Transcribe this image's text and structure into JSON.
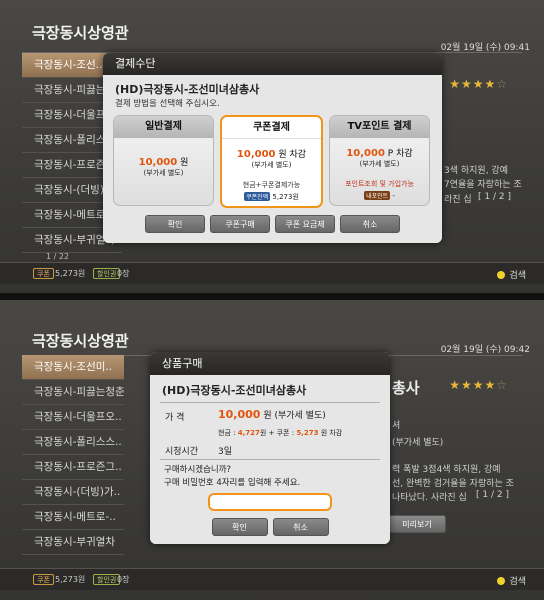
{
  "screen1": {
    "category_title": "극장동시상영관",
    "clock": "02월 19일 (수) 09:41",
    "menu": [
      "극장동시-조선..",
      "극장동시-피끓는",
      "극장동시-더울프",
      "극장동시-폴리스",
      "극장동시-프로즌",
      "극장동시-(더빙)",
      "극장동시-메트로",
      "극장동시-부귀열차"
    ],
    "page_indicator": "1 / 22",
    "bottom": {
      "coupon_label": "쿠폰",
      "coupon_value": "5,273원",
      "discount_label": "할인권",
      "discount_value": "0장",
      "search_label": "검색"
    },
    "desc_line1": "3색 하지원, 강예",
    "desc_line2": "7연율을 자랑하는 조",
    "desc_line3": "라진 십",
    "desc_page": "[ 1 / 2 ]",
    "stars": "★★★★",
    "star_empty": "☆",
    "dialog": {
      "header": "결제수단",
      "product_title": "(HD)극장동시-조선미녀삼총사",
      "subtitle": "결제 방법을 선택해 주십시오.",
      "cards": [
        {
          "title": "일반결제",
          "price": "10,000",
          "unit": " 원",
          "vat": "(부가세 별도)",
          "note": "",
          "row_tag": "",
          "row_text": ""
        },
        {
          "title": "쿠폰결제",
          "price": "10,000",
          "unit": " 원 차감",
          "vat": "(부가세 별도)",
          "note": "현금+쿠폰결제가능",
          "row_tag": "쿠폰잔액",
          "row_text": "5,273원"
        },
        {
          "title": "TV포인트 결제",
          "price": "10,000",
          "unit": " P 차감",
          "vat": "(부가세 별도)",
          "note": "포인트조회 및 가입가능",
          "row_tag": "내포인트",
          "row_text": "-"
        }
      ],
      "buttons": [
        "확인",
        "쿠폰구매",
        "쿠폰 요금제",
        "취소"
      ]
    }
  },
  "screen2": {
    "category_title": "극장동시상영관",
    "clock": "02월 19일 (수) 09:42",
    "menu": [
      "극장동시-조선미..",
      "극장동시-피끓는청춘",
      "극장동시-더울프오..",
      "극장동시-폴리스스..",
      "극장동시-프로즌그..",
      "극장동시-(더빙)가..",
      "극장동시-메트로-..",
      "극장동시-부귀열차"
    ],
    "bg_title": "총사",
    "stars": "★★★★",
    "star_empty": "☆",
    "desc_line0": "셔",
    "desc_vat": "(부가세 별도)",
    "desc_line1": "력 폭발 3점4색 하지원, 강예",
    "desc_line2": "선, 완벽한 검거율을 자랑하는 조",
    "desc_line3": "나타났다. 사라진 십",
    "desc_page": "[ 1 / 2 ]",
    "preview_label": "미리보기",
    "bottom": {
      "coupon_label": "쿠폰",
      "coupon_value": "5,273원",
      "discount_label": "할인권",
      "discount_value": "0장",
      "search_label": "검색"
    },
    "dialog": {
      "header": "상품구매",
      "product_title": "(HD)극장동시-조선미녀삼총사",
      "price_label": "가     격",
      "price": "10,000",
      "price_suffix": " 원 (부가세 별도)",
      "breakdown_prefix": "현금 : ",
      "cash": "4,727",
      "breakdown_mid": "원 + 쿠폰 : ",
      "coupon": "5,273",
      "breakdown_suffix": " 원 차감",
      "period_label": "시청시간",
      "period": "3일",
      "question": "구매하시겠습니까?",
      "instruction": "구매 비밀번호 4자리를 입력해 주세요.",
      "buttons": [
        "확인",
        "취소"
      ]
    }
  },
  "colors": {
    "accent_orange": "#f0951a",
    "price_orange": "#e0540c",
    "selected_menu": "#a5855f"
  }
}
